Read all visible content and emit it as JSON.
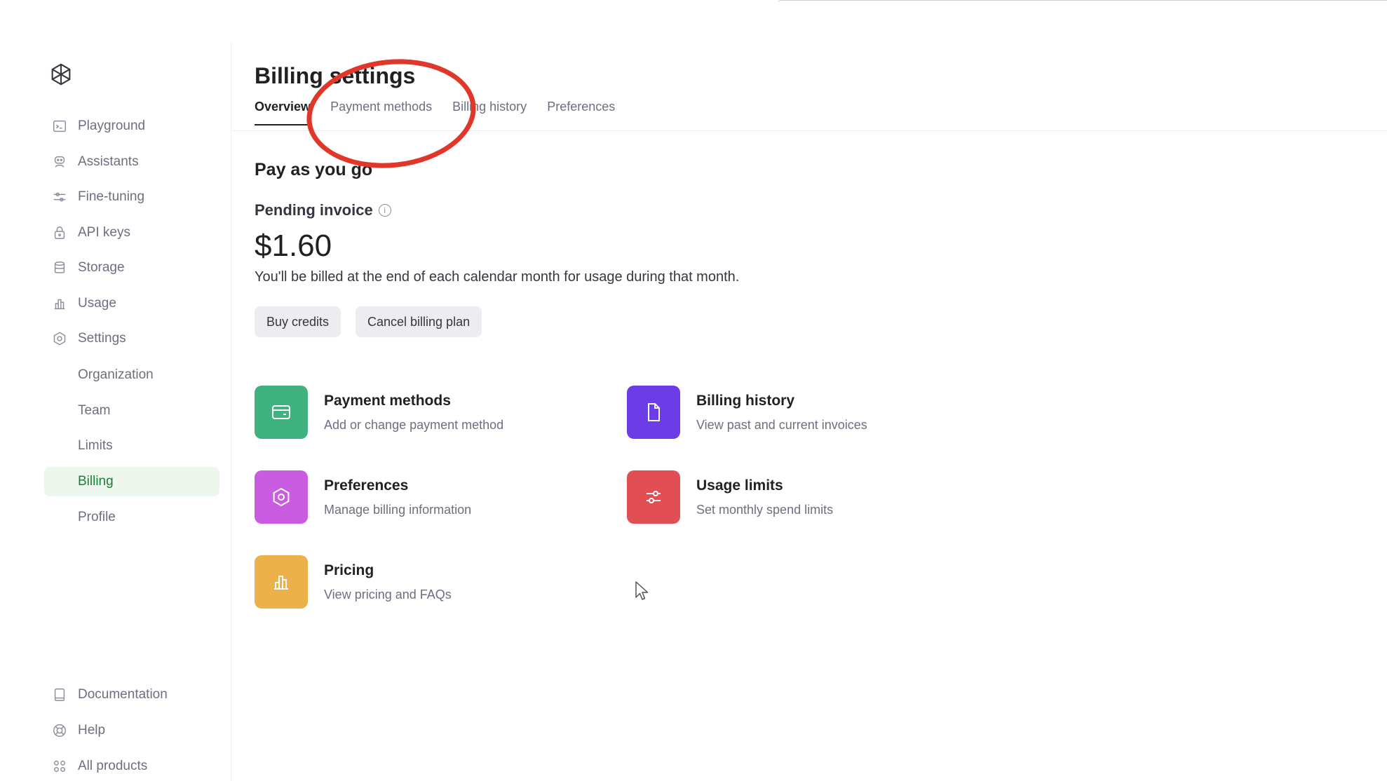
{
  "sidebar": {
    "logo_icon": "openai-logo-icon",
    "nav_items": [
      {
        "label": "Playground",
        "icon": "terminal-icon"
      },
      {
        "label": "Assistants",
        "icon": "robot-icon"
      },
      {
        "label": "Fine-tuning",
        "icon": "sliders-icon"
      },
      {
        "label": "API keys",
        "icon": "lock-icon"
      },
      {
        "label": "Storage",
        "icon": "database-icon"
      },
      {
        "label": "Usage",
        "icon": "bar-chart-icon"
      },
      {
        "label": "Settings",
        "icon": "gear-icon"
      }
    ],
    "settings_sub": [
      {
        "label": "Organization"
      },
      {
        "label": "Team"
      },
      {
        "label": "Limits"
      },
      {
        "label": "Billing",
        "active": true
      },
      {
        "label": "Profile"
      }
    ],
    "footer_items": [
      {
        "label": "Documentation",
        "icon": "book-icon"
      },
      {
        "label": "Help",
        "icon": "lifebuoy-icon"
      },
      {
        "label": "All products",
        "icon": "grid-icon"
      }
    ]
  },
  "main": {
    "title": "Billing settings",
    "tabs": [
      {
        "label": "Overview",
        "active": true
      },
      {
        "label": "Payment methods"
      },
      {
        "label": "Billing history"
      },
      {
        "label": "Preferences"
      }
    ],
    "plan_title": "Pay as you go",
    "pending_label": "Pending invoice",
    "amount": "$1.60",
    "description": "You'll be billed at the end of each calendar month for usage during that month.",
    "buttons": {
      "buy_credits": "Buy credits",
      "cancel_plan": "Cancel billing plan"
    },
    "cards": [
      {
        "title": "Payment methods",
        "subtitle": "Add or change payment method",
        "color": "#3fb27f",
        "icon": "credit-card-icon"
      },
      {
        "title": "Billing history",
        "subtitle": "View past and current invoices",
        "color": "#6c3ce6",
        "icon": "document-icon"
      },
      {
        "title": "Preferences",
        "subtitle": "Manage billing information",
        "color": "#c95ce0",
        "icon": "gear-icon"
      },
      {
        "title": "Usage limits",
        "subtitle": "Set monthly spend limits",
        "color": "#e14f55",
        "icon": "sliders-icon"
      },
      {
        "title": "Pricing",
        "subtitle": "View pricing and FAQs",
        "color": "#ecb14b",
        "icon": "bar-chart-icon"
      }
    ]
  },
  "colors": {
    "active_nav_bg": "#edf7ee",
    "active_nav_text": "#1a7f37",
    "annotation": "#e0372a"
  }
}
